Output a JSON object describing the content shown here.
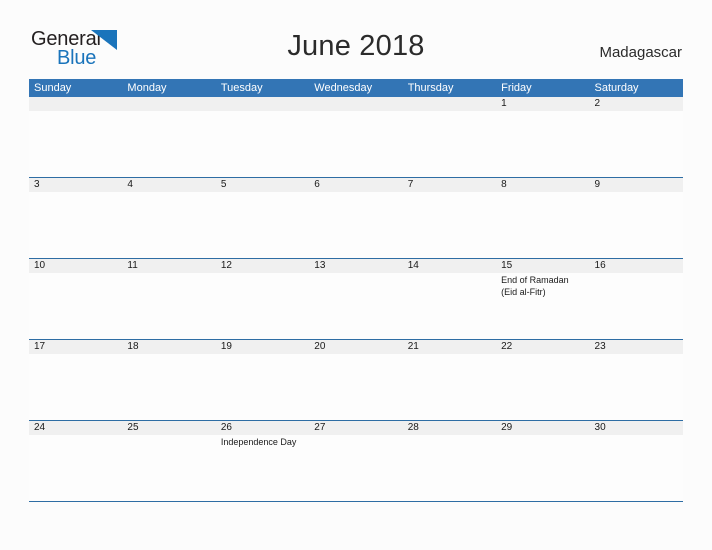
{
  "brand": {
    "name_part1": "General",
    "name_part2": "Blue",
    "flag_icon": "triangle-flag-icon",
    "accent_color": "#1a74bb"
  },
  "header": {
    "title": "June 2018",
    "country": "Madagascar"
  },
  "colors": {
    "header_bar": "#3375b5",
    "week_rule": "#2e6da4",
    "date_band": "#f0f0f0",
    "page_background": "#fcfcfc"
  },
  "weekdays": [
    "Sunday",
    "Monday",
    "Tuesday",
    "Wednesday",
    "Thursday",
    "Friday",
    "Saturday"
  ],
  "weeks": [
    {
      "days": [
        {
          "num": "",
          "events": []
        },
        {
          "num": "",
          "events": []
        },
        {
          "num": "",
          "events": []
        },
        {
          "num": "",
          "events": []
        },
        {
          "num": "",
          "events": []
        },
        {
          "num": "1",
          "events": []
        },
        {
          "num": "2",
          "events": []
        }
      ]
    },
    {
      "days": [
        {
          "num": "3",
          "events": []
        },
        {
          "num": "4",
          "events": []
        },
        {
          "num": "5",
          "events": []
        },
        {
          "num": "6",
          "events": []
        },
        {
          "num": "7",
          "events": []
        },
        {
          "num": "8",
          "events": []
        },
        {
          "num": "9",
          "events": []
        }
      ]
    },
    {
      "days": [
        {
          "num": "10",
          "events": []
        },
        {
          "num": "11",
          "events": []
        },
        {
          "num": "12",
          "events": []
        },
        {
          "num": "13",
          "events": []
        },
        {
          "num": "14",
          "events": []
        },
        {
          "num": "15",
          "events": [
            "End of Ramadan",
            "(Eid al-Fitr)"
          ]
        },
        {
          "num": "16",
          "events": []
        }
      ]
    },
    {
      "days": [
        {
          "num": "17",
          "events": []
        },
        {
          "num": "18",
          "events": []
        },
        {
          "num": "19",
          "events": []
        },
        {
          "num": "20",
          "events": []
        },
        {
          "num": "21",
          "events": []
        },
        {
          "num": "22",
          "events": []
        },
        {
          "num": "23",
          "events": []
        }
      ]
    },
    {
      "days": [
        {
          "num": "24",
          "events": []
        },
        {
          "num": "25",
          "events": []
        },
        {
          "num": "26",
          "events": [
            "Independence Day"
          ]
        },
        {
          "num": "27",
          "events": []
        },
        {
          "num": "28",
          "events": []
        },
        {
          "num": "29",
          "events": []
        },
        {
          "num": "30",
          "events": []
        }
      ]
    }
  ]
}
